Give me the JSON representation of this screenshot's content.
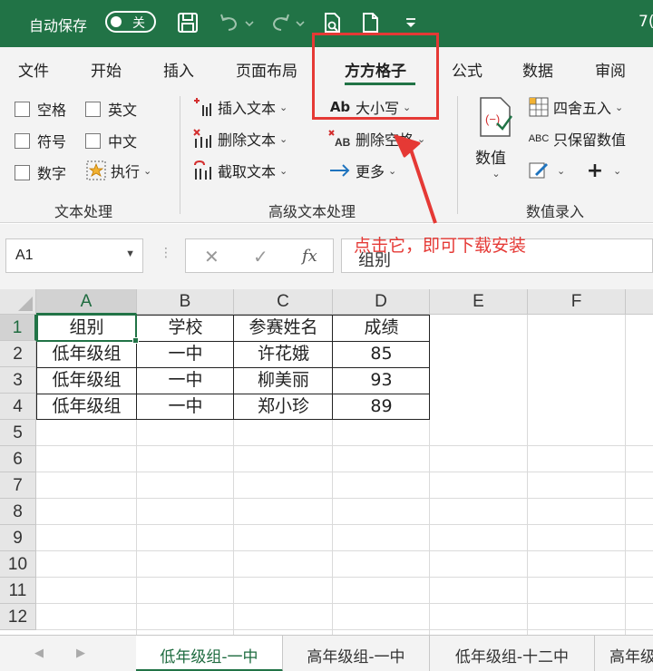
{
  "titlebar": {
    "autosave_label": "自动保存",
    "toggle_label": "关",
    "trailing_text": "7("
  },
  "tabs": [
    "文件",
    "开始",
    "插入",
    "页面布局",
    "方方格子",
    "公式",
    "数据",
    "审阅"
  ],
  "active_tab": "方方格子",
  "ribbon": {
    "text_processing": {
      "checkboxes": [
        "空格",
        "英文",
        "符号",
        "中文",
        "数字"
      ],
      "execute_label": "执行",
      "group_label": "文本处理"
    },
    "advanced_text": {
      "insert_text": "插入文本",
      "delete_text": "删除文本",
      "extract_text": "截取文本",
      "case_label": "大小写",
      "delete_spaces": "删除空格",
      "more_label": "更多",
      "group_label": "高级文本处理"
    },
    "number_entry": {
      "numeric_label": "数值",
      "round_label": "四舍五入",
      "keep_numeric": "只保留数值",
      "group_label": "数值录入"
    }
  },
  "formula_bar": {
    "name_box": "A1",
    "fx": "fx",
    "content": "组别"
  },
  "grid": {
    "columns": [
      "A",
      "B",
      "C",
      "D",
      "E",
      "F"
    ],
    "rows": [
      "1",
      "2",
      "3",
      "4",
      "5",
      "6",
      "7",
      "8",
      "9",
      "10",
      "11",
      "12"
    ],
    "data": [
      [
        "组别",
        "学校",
        "参赛姓名",
        "成绩"
      ],
      [
        "低年级组",
        "一中",
        "许花娥",
        "85"
      ],
      [
        "低年级组",
        "一中",
        "柳美丽",
        "93"
      ],
      [
        "低年级组",
        "一中",
        "郑小珍",
        "89"
      ]
    ]
  },
  "sheet_tabs": [
    "低年级组-一中",
    "高年级组-一中",
    "低年级组-十二中",
    "高年级"
  ],
  "annotation": "点击它，即可下载安装",
  "colors": {
    "accent": "#217346",
    "annotation": "#e53935"
  }
}
